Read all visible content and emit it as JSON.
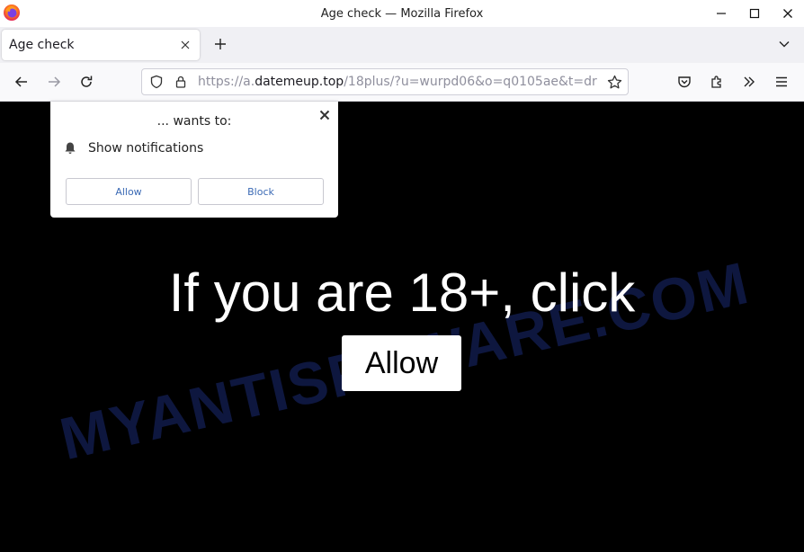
{
  "window": {
    "title": "Age check — Mozilla Firefox",
    "controls": [
      "minimize",
      "maximize",
      "close"
    ]
  },
  "tabs": [
    {
      "label": "Age check",
      "active": true
    }
  ],
  "toolbar": {
    "url_prefix": "https://a.",
    "url_host": "datemeup.top",
    "url_path": "/18plus/?u=wurpd06&o=q0105ae&t=dr"
  },
  "popup": {
    "title": "... wants to:",
    "permission": "Show notifications",
    "allow_label": "Allow",
    "block_label": "Block"
  },
  "content": {
    "headline": "If you are 18+, click",
    "allow_label": "Allow",
    "watermark": "MYANTISPYWARE.COM"
  },
  "colors": {
    "page_background": "#000000",
    "headline_text": "#ffffff",
    "popup_button_text": "#3b6ab5",
    "watermark": "#1e328c"
  },
  "icons": {
    "titlebar": "firefox-logo-icon",
    "nav": [
      "back-arrow-icon",
      "forward-arrow-icon",
      "reload-icon"
    ],
    "urlbar": [
      "shield-icon",
      "lock-icon",
      "bookmark-star-icon"
    ],
    "right": [
      "pocket-icon",
      "extensions-icon",
      "overflow-chevron-icon",
      "hamburger-menu-icon"
    ]
  }
}
